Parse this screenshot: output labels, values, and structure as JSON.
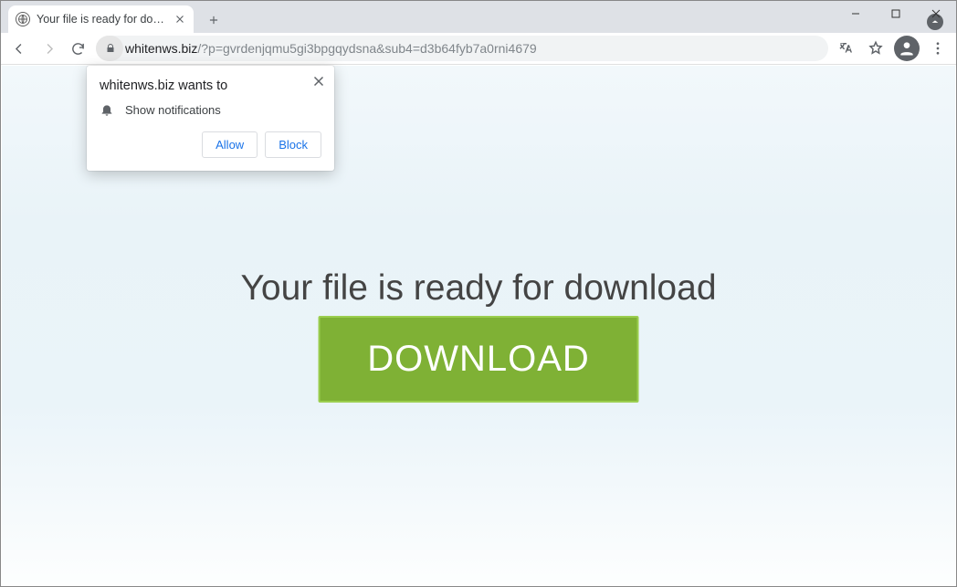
{
  "tab": {
    "title": "Your file is ready for download"
  },
  "url": {
    "host": "whitenws.biz",
    "path": "/?p=gvrdenjqmu5gi3bpgqydsna&sub4=d3b64fyb7a0rni4679"
  },
  "permission": {
    "origin_prompt": "whitenws.biz wants to",
    "capability": "Show notifications",
    "allow": "Allow",
    "block": "Block"
  },
  "page": {
    "headline": "Your file is ready for download",
    "button": "DOWNLOAD"
  }
}
